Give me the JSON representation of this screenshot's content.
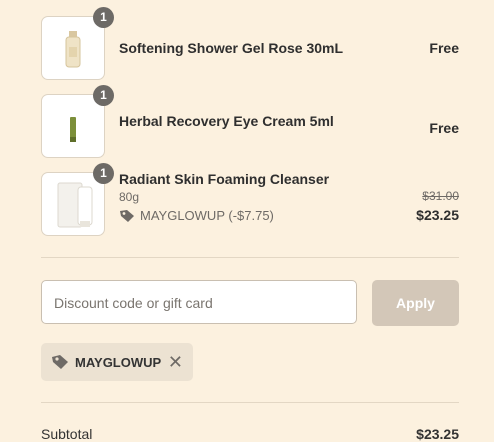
{
  "items": [
    {
      "quantity": "1",
      "name": "Softening Shower Gel Rose 30mL",
      "price": "Free"
    },
    {
      "quantity": "1",
      "name": "Herbal Recovery Eye Cream 5ml",
      "price": "Free"
    },
    {
      "quantity": "1",
      "name": "Radiant Skin Foaming Cleanser",
      "variant": "80g",
      "discount": "MAYGLOWUP (-$7.75)",
      "original_price": "$31.00",
      "price": "$23.25"
    }
  ],
  "discount_form": {
    "placeholder": "Discount code or gift card",
    "apply_label": "Apply"
  },
  "applied_code": "MAYGLOWUP",
  "subtotal": {
    "label": "Subtotal",
    "value": "$23.25"
  },
  "colors": {
    "background": "#fcf1df",
    "apply_disabled": "#d3c7b8",
    "chip": "#ece2d2"
  }
}
